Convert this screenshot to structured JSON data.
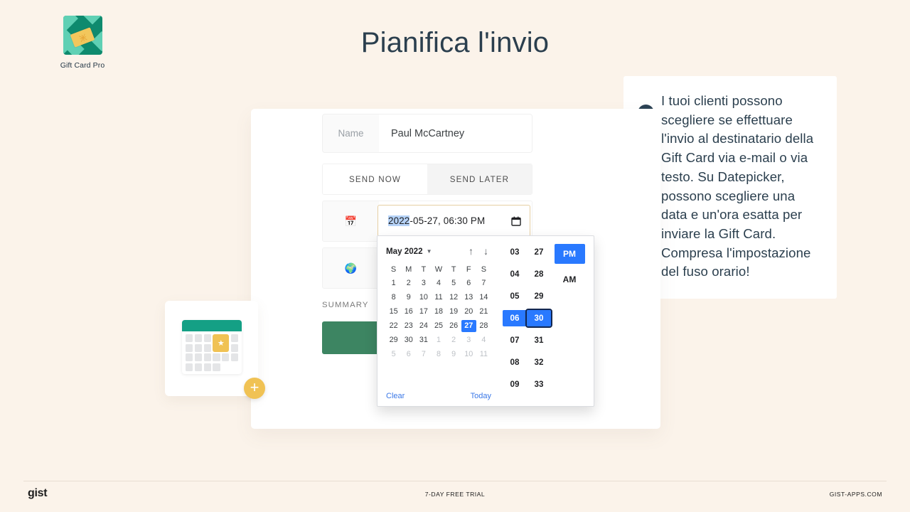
{
  "brand": {
    "name": "Gift Card Pro",
    "logo_icon": "gift-card-logo",
    "accent_green": "#0e8a6e",
    "accent_yellow": "#f2c75c"
  },
  "page": {
    "title": "Pianifica l'invio",
    "background": "#fbf3ea",
    "title_color": "#2b3f4e"
  },
  "callout": {
    "arrow_icon": "chevron-right-icon",
    "text": "I tuoi clienti possono scegliere se effettuare l'invio al destinatario della Gift Card via e-mail o via testo. Su Datepicker, possono scegliere una data e un'ora esatta per inviare la Gift Card. Compresa l'impostazione del fuso orario!"
  },
  "illustration": {
    "icon": "calendar-illustration",
    "star_glyph": "★",
    "plus_glyph": "+"
  },
  "form": {
    "name_field": {
      "label": "Name",
      "value": "Paul McCartney"
    },
    "tabs": [
      {
        "label": "SEND NOW",
        "active": false
      },
      {
        "label": "SEND LATER",
        "active": true
      }
    ],
    "date_row_icon": "calendar-emoji-icon",
    "date_row_icon_glyph": "📅",
    "timezone_row_icon": "globe-emoji-icon",
    "timezone_row_icon_glyph": "🌍",
    "date_input": {
      "selected_part": "2022",
      "rest": "-05-27, 06:30 PM",
      "full_value": "2022-05-27, 06:30 PM",
      "calendar_button_icon": "calendar-icon"
    },
    "summary_label": "SUMMARY",
    "summary_bar_color": "#3d8562"
  },
  "datepicker": {
    "month_label": "May 2022",
    "caret_icon": "chevron-down-icon",
    "prev_icon": "arrow-up-icon",
    "prev_glyph": "↑",
    "next_icon": "arrow-down-icon",
    "next_glyph": "↓",
    "weekdays": [
      "S",
      "M",
      "T",
      "W",
      "T",
      "F",
      "S"
    ],
    "weeks": [
      [
        {
          "d": "1",
          "mute": false
        },
        {
          "d": "2",
          "mute": false
        },
        {
          "d": "3",
          "mute": false
        },
        {
          "d": "4",
          "mute": false
        },
        {
          "d": "5",
          "mute": false
        },
        {
          "d": "6",
          "mute": false
        },
        {
          "d": "7",
          "mute": false
        }
      ],
      [
        {
          "d": "8",
          "mute": false
        },
        {
          "d": "9",
          "mute": false
        },
        {
          "d": "10",
          "mute": false
        },
        {
          "d": "11",
          "mute": false
        },
        {
          "d": "12",
          "mute": false
        },
        {
          "d": "13",
          "mute": false
        },
        {
          "d": "14",
          "mute": false
        }
      ],
      [
        {
          "d": "15",
          "mute": false
        },
        {
          "d": "16",
          "mute": false
        },
        {
          "d": "17",
          "mute": false
        },
        {
          "d": "18",
          "mute": false
        },
        {
          "d": "19",
          "mute": false
        },
        {
          "d": "20",
          "mute": false
        },
        {
          "d": "21",
          "mute": false
        }
      ],
      [
        {
          "d": "22",
          "mute": false
        },
        {
          "d": "23",
          "mute": false
        },
        {
          "d": "24",
          "mute": false
        },
        {
          "d": "25",
          "mute": false
        },
        {
          "d": "26",
          "mute": false
        },
        {
          "d": "27",
          "mute": false,
          "sel": true
        },
        {
          "d": "28",
          "mute": false
        }
      ],
      [
        {
          "d": "29",
          "mute": false
        },
        {
          "d": "30",
          "mute": false
        },
        {
          "d": "31",
          "mute": false
        },
        {
          "d": "1",
          "mute": true
        },
        {
          "d": "2",
          "mute": true
        },
        {
          "d": "3",
          "mute": true
        },
        {
          "d": "4",
          "mute": true
        }
      ],
      [
        {
          "d": "5",
          "mute": true
        },
        {
          "d": "6",
          "mute": true
        },
        {
          "d": "7",
          "mute": true
        },
        {
          "d": "8",
          "mute": true
        },
        {
          "d": "9",
          "mute": true
        },
        {
          "d": "10",
          "mute": true
        },
        {
          "d": "11",
          "mute": true
        }
      ]
    ],
    "selected_day": "27",
    "clear_label": "Clear",
    "today_label": "Today",
    "hours": [
      "03",
      "04",
      "05",
      "06",
      "07",
      "08",
      "09"
    ],
    "selected_hour": "06",
    "minutes": [
      "27",
      "28",
      "29",
      "30",
      "31",
      "32",
      "33"
    ],
    "selected_minute": "30",
    "meridiem": [
      "PM",
      "AM"
    ],
    "selected_meridiem": "PM",
    "accent_blue": "#2979ff"
  },
  "footer": {
    "logo": "gist",
    "center": "7-DAY FREE TRIAL",
    "right": "GIST-APPS.COM"
  }
}
